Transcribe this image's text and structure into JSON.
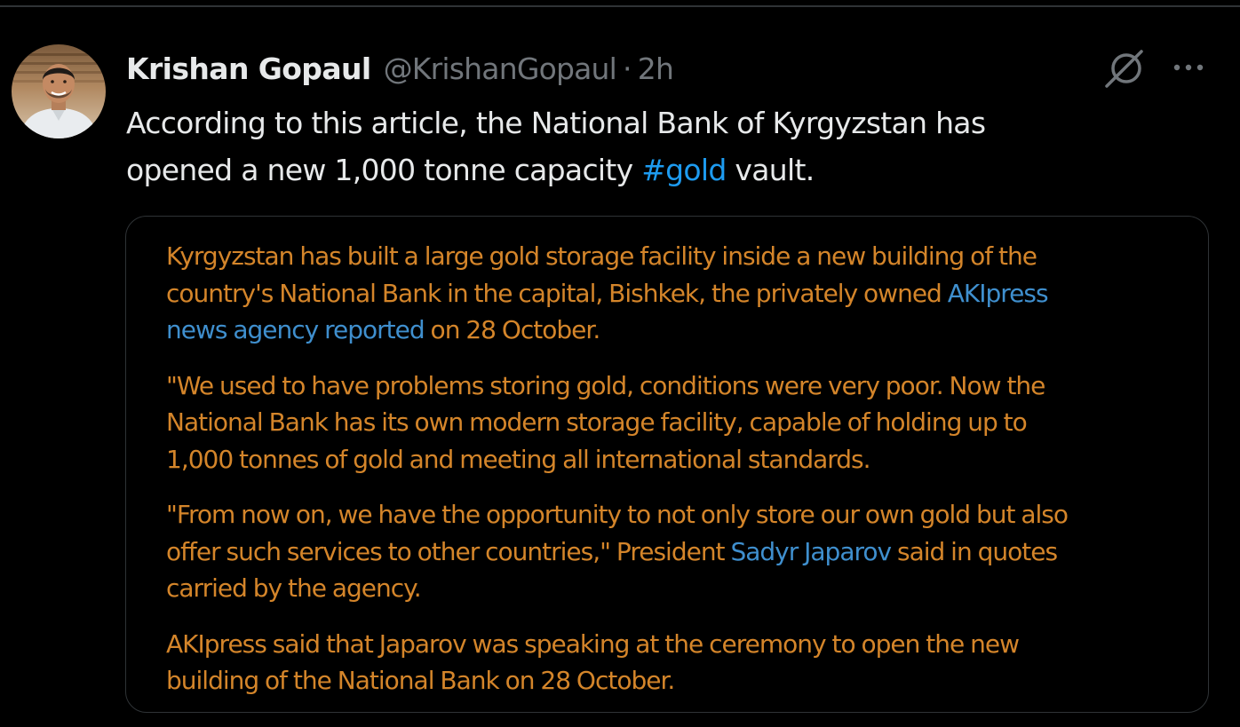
{
  "tweet": {
    "author_name": "Krishan Gopaul",
    "author_handle": "@KrishanGopaul",
    "separator": "·",
    "timestamp": "2h",
    "text_line1": "According to this article, the National Bank of Kyrgyzstan has",
    "text_line2_pre": "opened a new 1,000 tonne capacity ",
    "hashtag": "#gold",
    "text_line2_post": " vault."
  },
  "icons": {
    "grok": "grok-icon",
    "more": "more-icon"
  },
  "article": {
    "p1_l1": "Kyrgyzstan has built a large gold storage facility inside a new building of the",
    "p1_l2_pre": "country's National Bank in the capital, Bishkek, the privately owned ",
    "p1_link1": "AKIpress",
    "p1_link2": "news agency reported",
    "p1_l3_post": " on 28 October.",
    "p2_l1": "\"We used to have problems storing gold, conditions were very poor. Now the",
    "p2_l2": "National Bank has its own modern storage facility, capable of holding up to",
    "p2_l3": "1,000 tonnes of gold and meeting all international standards.",
    "p3_l1": "\"From now on, we have the opportunity to not only store our own gold but also",
    "p3_l2_pre": "offer such services to other countries,\" President ",
    "p3_link": "Sadyr Japarov",
    "p3_l2_post": " said in quotes",
    "p3_l3": "carried by the agency.",
    "p4_l1": "AKIpress said that Japarov was speaking at the ceremony to open the new",
    "p4_l2": "building of the National Bank on 28 October."
  },
  "colors": {
    "background": "#000000",
    "text_primary": "#e7e9ea",
    "text_secondary": "#71767b",
    "link_blue": "#1d9bf0",
    "article_orange": "#d4852a",
    "article_link": "#3f8fce",
    "border": "#2f3336"
  }
}
